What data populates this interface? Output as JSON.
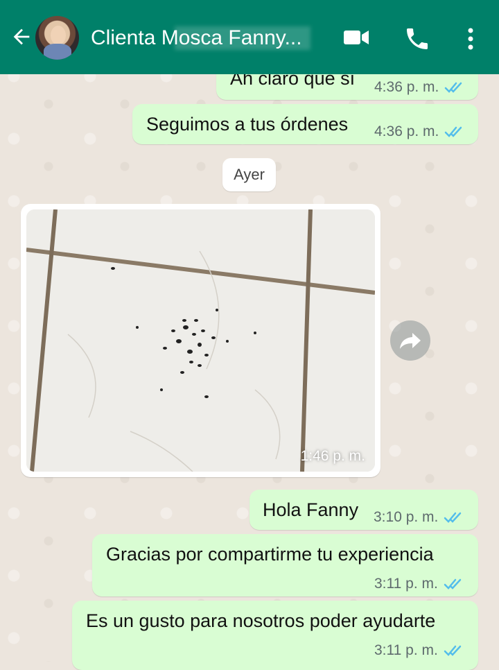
{
  "header": {
    "title": "Clienta Mosca Fanny...",
    "back_icon": "arrow-left-icon",
    "video_icon": "video-call-icon",
    "call_icon": "phone-icon",
    "more_icon": "more-vertical-icon",
    "bg_color": "#008069"
  },
  "messages": [
    {
      "text": "Ah claro que sí",
      "time": "4:36 p. m."
    },
    {
      "text": "Seguimos a tus órdenes",
      "time": "4:36 p. m."
    },
    {
      "text": "Hola Fanny",
      "time": "3:10 p. m."
    },
    {
      "text": "Gracias por compartirme tu experiencia",
      "time": "3:11 p. m."
    },
    {
      "text": "Es un gusto para nosotros poder ayudarte",
      "time": "3:11 p. m."
    }
  ],
  "date_divider": "Ayer",
  "photo_message": {
    "time": "1:46 p. m."
  },
  "colors": {
    "outgoing_bubble": "#d9fdd3",
    "read_ticks": "#53bdeb"
  }
}
